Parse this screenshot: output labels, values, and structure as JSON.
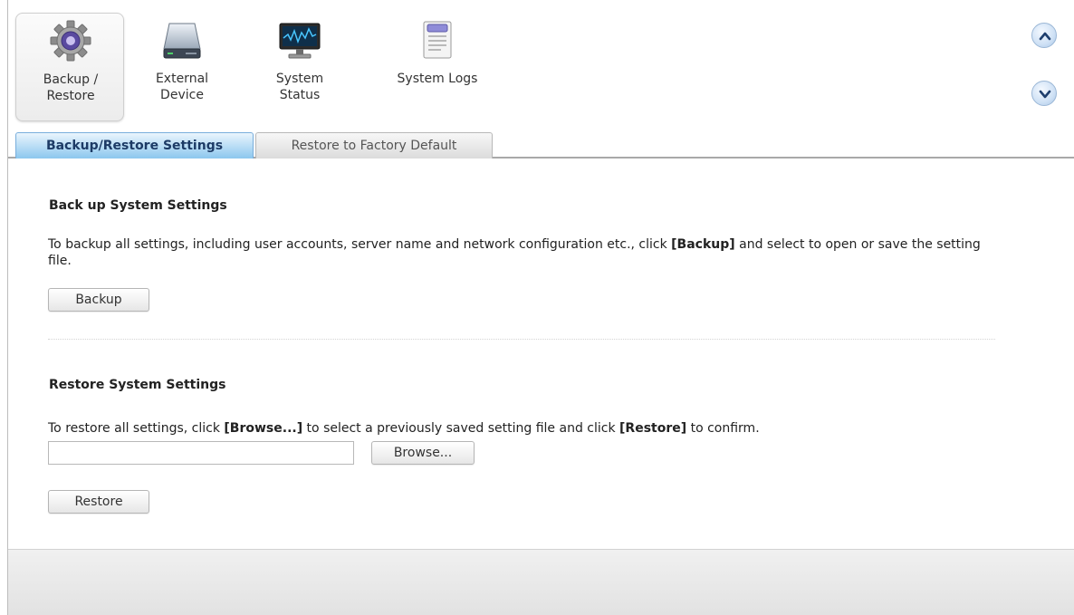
{
  "toolbar": {
    "items": [
      {
        "label": "Backup /\nRestore",
        "icon": "gear-icon",
        "active": true
      },
      {
        "label": "External\nDevice",
        "icon": "drive-icon",
        "active": false
      },
      {
        "label": "System\nStatus",
        "icon": "monitor-icon",
        "active": false
      },
      {
        "label": "System Logs",
        "icon": "log-icon",
        "active": false
      }
    ],
    "scroll_up_icon": "chevron-up-icon",
    "scroll_down_icon": "chevron-down-icon"
  },
  "tabs": [
    {
      "label": "Backup/Restore Settings",
      "active": true
    },
    {
      "label": "Restore to Factory Default",
      "active": false
    }
  ],
  "backup": {
    "heading": "Back up System Settings",
    "desc_prefix": "To backup all settings, including user accounts, server name and network configuration etc., click ",
    "desc_bold": "[Backup]",
    "desc_suffix": " and select to open or save the setting file.",
    "button_label": "Backup"
  },
  "restore": {
    "heading": "Restore System Settings",
    "desc_prefix": "To restore all settings, click ",
    "desc_bold1": "[Browse...]",
    "desc_middle": " to select a previously saved setting file and click ",
    "desc_bold2": "[Restore]",
    "desc_suffix": " to confirm.",
    "file_value": "",
    "browse_label": "Browse...",
    "button_label": "Restore"
  },
  "colors": {
    "active_tab_top": "#eaf5fd",
    "active_tab_bottom": "#8cc7ee",
    "active_tab_text": "#1d3b66",
    "scroll_button": "#cfe1f5"
  }
}
